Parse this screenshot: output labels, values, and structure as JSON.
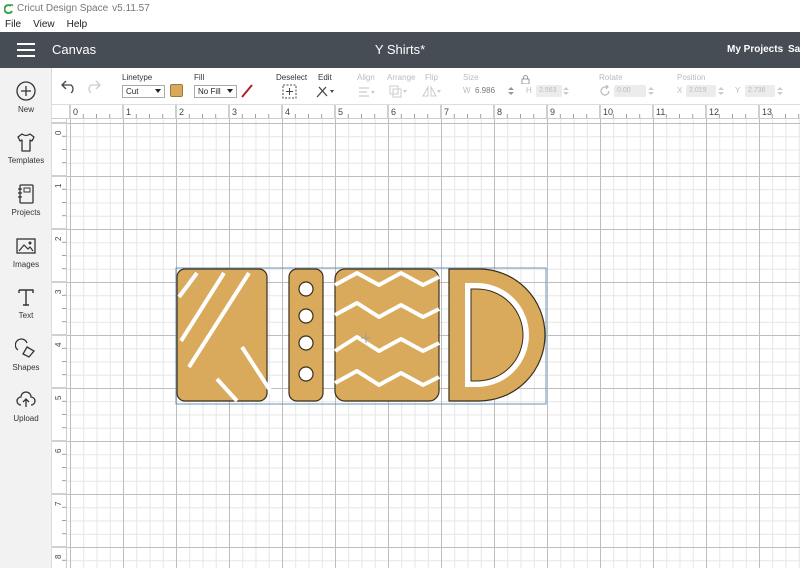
{
  "window": {
    "app_name": "Cricut Design Space",
    "version": "v5.11.57"
  },
  "menu": [
    "File",
    "View",
    "Help"
  ],
  "header": {
    "canvas_label": "Canvas",
    "project_title": "Y Shirts*",
    "my_projects": "My Projects",
    "save_partial": "Sa"
  },
  "sidebar": [
    {
      "label": "New",
      "icon": "plus-circle-icon"
    },
    {
      "label": "Templates",
      "icon": "tshirt-icon"
    },
    {
      "label": "Projects",
      "icon": "notebook-icon"
    },
    {
      "label": "Images",
      "icon": "image-icon"
    },
    {
      "label": "Text",
      "icon": "text-t-icon"
    },
    {
      "label": "Shapes",
      "icon": "shapes-icon"
    },
    {
      "label": "Upload",
      "icon": "cloud-upload-icon"
    }
  ],
  "toolbar": {
    "linetype_label": "Linetype",
    "linetype_value": "Cut",
    "linetype_color": "#d9aa5b",
    "fill_label": "Fill",
    "fill_value": "No Fill",
    "deselect_label": "Deselect",
    "edit_label": "Edit",
    "align_label": "Align",
    "arrange_label": "Arrange",
    "flip_label": "Flip",
    "size_label": "Size",
    "w_label": "W",
    "w_value": "6.986",
    "h_label": "H",
    "h_value": "2.563",
    "rotate_label": "Rotate",
    "rotate_value": "0.00",
    "position_label": "Position",
    "x_label": "X",
    "x_value": "2.019",
    "y_label": "Y",
    "y_value": "2.736"
  },
  "rulers": {
    "top": [
      "0",
      "1",
      "2",
      "3",
      "4",
      "5",
      "6",
      "7",
      "8",
      "9",
      "10",
      "11",
      "12",
      "13"
    ],
    "left": [
      "0",
      "1",
      "2",
      "3",
      "4",
      "5",
      "6",
      "7",
      "8"
    ]
  },
  "canvas": {
    "design_text": "KIND",
    "design_color": "#d9aa5b"
  }
}
